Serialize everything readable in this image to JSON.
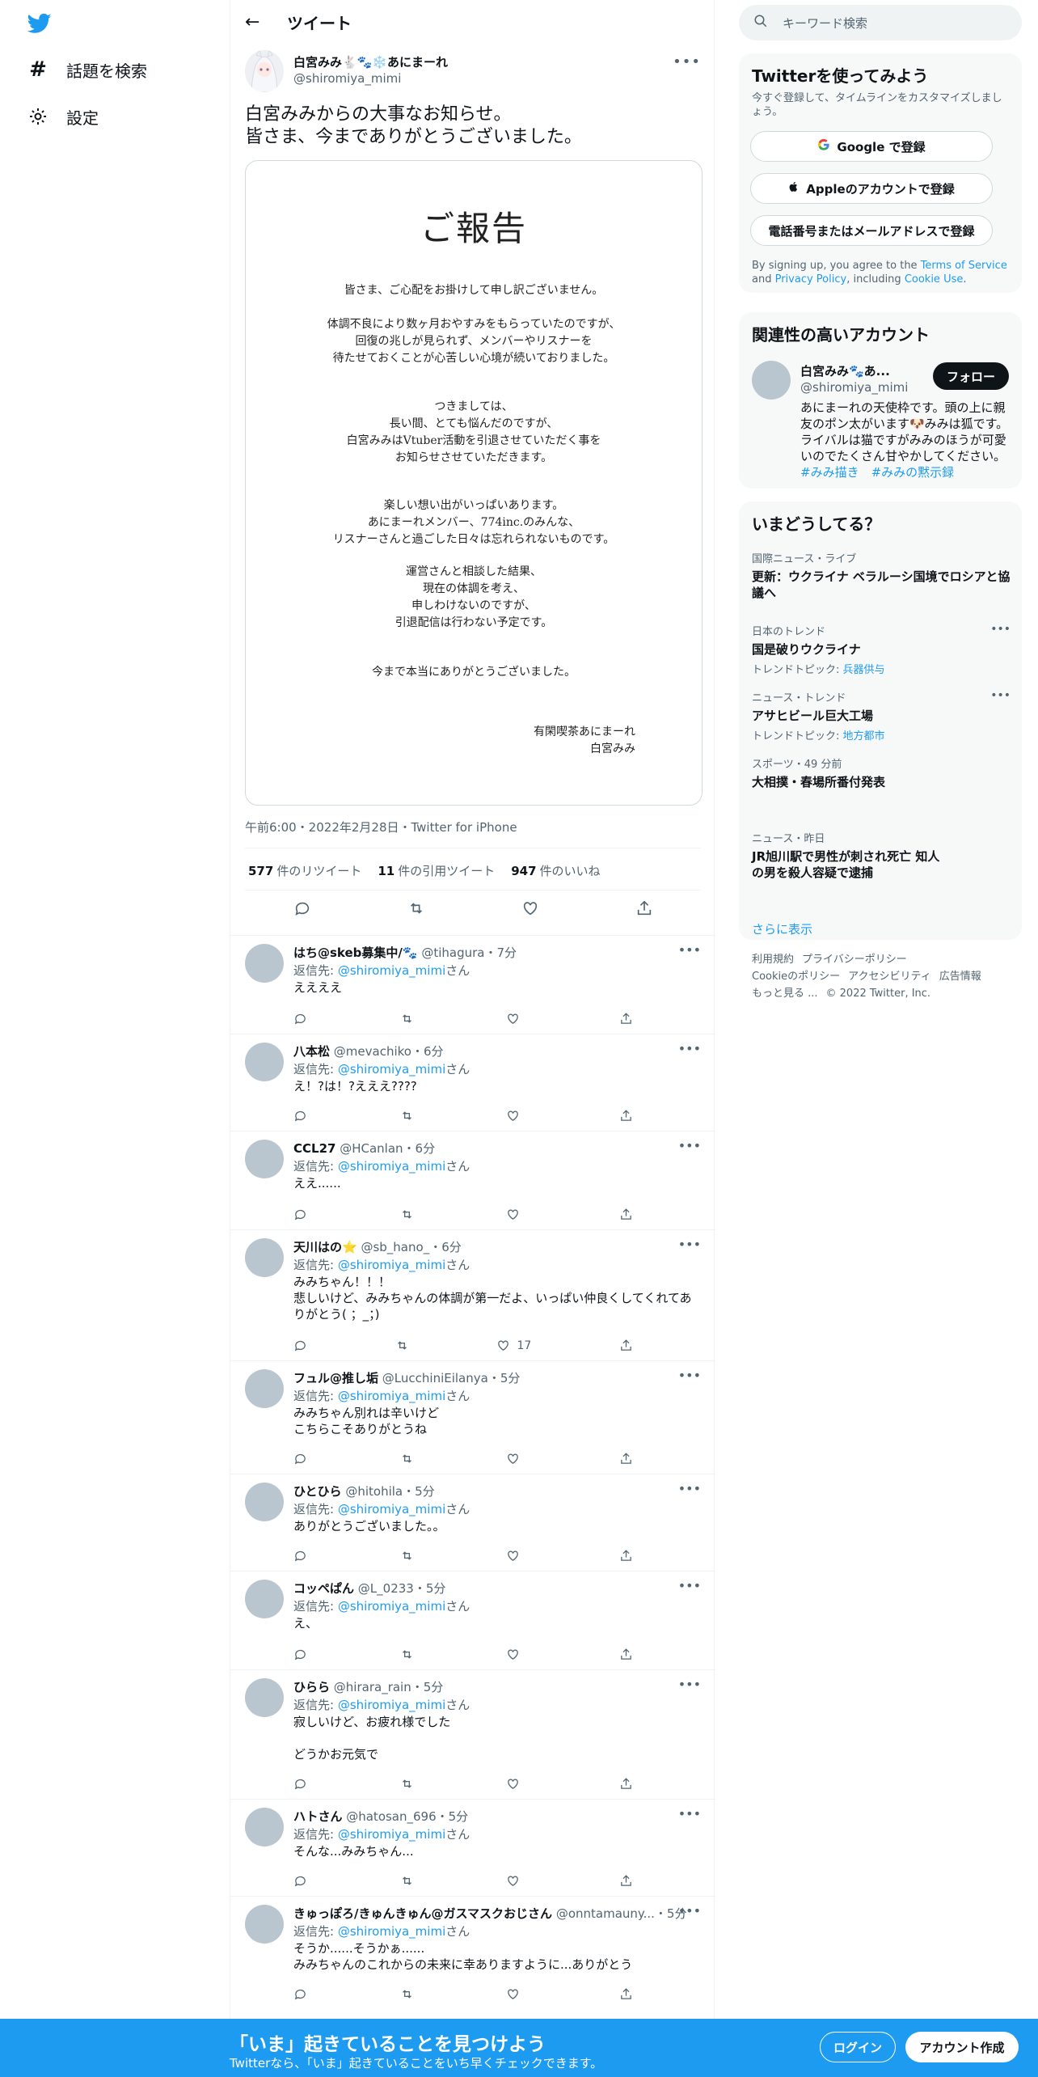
{
  "nav": {
    "explore": "話題を検索",
    "settings": "設定"
  },
  "header": {
    "title": "ツイート"
  },
  "tweet": {
    "name": "白宮みみ🐇🐾❄️あにまーれ",
    "handle": "@shiromiya_mimi",
    "text": "白宮みみからの大事なお知らせ。\n皆さま、今までありがとうございました。",
    "notice": {
      "title": "ご報告",
      "p1": "皆さま、ご心配をお掛けして申し訳ございません。",
      "p2": "体調不良により数ヶ月おやすみをもらっていたのですが、\n回復の兆しが見られず、メンバーやリスナーを\n待たせておくことが心苦しい心境が続いておりました。",
      "p3": "つきましては、\n長い間、とても悩んだのですが、\n白宮みみはVtuber活動を引退させていただく事を\nお知らせさせていただきます。",
      "p4": "楽しい想い出がいっぱいあります。\nあにまーれメンバー、774inc.のみんな、\nリスナーさんと過ごした日々は忘れられないものです。",
      "p5": "運営さんと相談した結果、\n現在の体調を考え、\n申しわけないのですが、\n引退配信は行わない予定です。",
      "p6": "今まで本当にありがとうございました。",
      "signature": "有閑喫茶あにまーれ\n白宮みみ"
    },
    "meta": "午前6:00・2022年2月28日・Twitter for iPhone",
    "retweets": "577",
    "retweets_label": "件のリツイート",
    "quotes": "11",
    "quotes_label": "件の引用ツイート",
    "likes": "947",
    "likes_label": "件のいいね"
  },
  "reply_to_label": "返信先: ",
  "reply_to_handle": "@shiromiya_mimi",
  "reply_to_suffix": "さん",
  "replies": [
    {
      "name": "はち@skeb募集中/🐾",
      "handle": "@tihagura・7分",
      "text": "ええええ",
      "likes": ""
    },
    {
      "name": "八本松",
      "handle": "@mevachiko・6分",
      "text": "え！?は！?えええ????",
      "likes": ""
    },
    {
      "name": "CCL27",
      "handle": "@HCanlan・6分",
      "text": "ええ......",
      "likes": ""
    },
    {
      "name": "天川はの⭐",
      "handle": "@sb_hano_・6分",
      "text": "みみちゃん！！！\n悲しいけど、みみちゃんの体調が第一だよ、いっぱい仲良くしてくれてありがとう( ；_；)",
      "likes": "17"
    },
    {
      "name": "フュル@推し垢",
      "handle": "@LucchiniEilanya・5分",
      "text": "みみちゃん別れは辛いけど\nこちらこそありがとうね",
      "likes": ""
    },
    {
      "name": "ひとひら",
      "handle": "@hitohila・5分",
      "text": "ありがとうございました。。",
      "likes": ""
    },
    {
      "name": "コッペぱん",
      "handle": "@L_0233・5分",
      "text": "え、",
      "likes": ""
    },
    {
      "name": "ひらら",
      "handle": "@hirara_rain・5分",
      "text": "寂しいけど、お疲れ様でした\n\nどうかお元気で",
      "likes": ""
    },
    {
      "name": "ハトさん",
      "handle": "@hatosan_696・5分",
      "text": "そんな...みみちゃん...",
      "likes": ""
    },
    {
      "name": "きゅっぽろ/きゅんきゅん@ガスマスクおじさん",
      "handle": "@onntamauny...・5分",
      "text": "そうか......そうかぁ......\nみみちゃんのこれからの未来に幸ありますように...ありがとう",
      "likes": ""
    }
  ],
  "search": {
    "placeholder": "キーワード検索"
  },
  "signup_card": {
    "title": "Twitterを使ってみよう",
    "subtitle": "今すぐ登録して、タイムラインをカスタマイズしましょう。",
    "google": "Google で登録",
    "apple": "Appleのアカウントで登録",
    "phone": "電話番号またはメールアドレスで登録",
    "legal_prefix": "By signing up, you agree to the ",
    "terms": "Terms of Service",
    "and": " and ",
    "privacy": "Privacy Policy",
    "including": ", including ",
    "cookie": "Cookie Use",
    "period": "."
  },
  "related": {
    "title": "関連性の高いアカウント",
    "name": "白宮みみ🐾あ...",
    "handle": "@shiromiya_mimi",
    "follow": "フォロー",
    "bio": "あにまーれの天使枠です。頭の上に親友のポン太がいます🐶みみは狐です。ライバルは猫ですがみみのほうが可愛いのでたくさん甘やかしてください。",
    "tags": "#みみ描き　#みみの黙示録"
  },
  "trends": {
    "title": "いまどうしてる？",
    "items": [
      {
        "category": "国際ニュース・ライブ",
        "title": "更新：ウクライナ ベラルーシ国境でロシアと協議へ",
        "topic_label": "",
        "topic": ""
      },
      {
        "category": "日本のトレンド",
        "title": "国是破りウクライナ",
        "topic_label": "トレンドトピック: ",
        "topic": "兵器供与"
      },
      {
        "category": "ニュース・トレンド",
        "title": "アサヒビール巨大工場",
        "topic_label": "トレンドトピック: ",
        "topic": "地方都市"
      },
      {
        "category": "スポーツ・49 分前",
        "title": "大相撲・春場所番付発表",
        "topic_label": "",
        "topic": ""
      },
      {
        "category": "ニュース・昨日",
        "title": "JR旭川駅で男性が刺され死亡 知人\nの男を殺人容疑で逮捕",
        "topic_label": "",
        "topic": ""
      }
    ],
    "show_more": "さらに表示"
  },
  "footer": {
    "line1": [
      "利用規約",
      "プライバシーポリシー"
    ],
    "line2": [
      "Cookieのポリシー",
      "アクセシビリティ",
      "広告情報"
    ],
    "line3": [
      "もっと見る ...",
      "© 2022 Twitter, Inc."
    ]
  },
  "bottom": {
    "title": "「いま」起きていることを見つけよう",
    "subtitle": "Twitterなら、「いま」起きていることをいち早くチェックできます。",
    "login": "ログイン",
    "signup": "アカウント作成"
  },
  "colors": {
    "accent": "#1d9bf0",
    "text": "#0f1419",
    "muted": "#536471"
  }
}
